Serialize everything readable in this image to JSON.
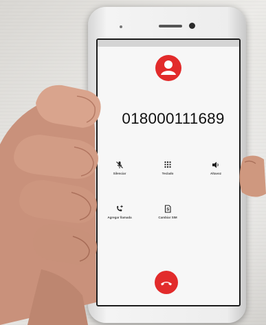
{
  "call": {
    "number": "018000111689",
    "avatar_icon": "person-icon",
    "accent_color": "#e22b2b"
  },
  "controls": [
    {
      "label": "Silenciar",
      "icon": "mute-icon"
    },
    {
      "label": "Teclado",
      "icon": "dialpad-icon"
    },
    {
      "label": "Altavoz",
      "icon": "speaker-icon"
    },
    {
      "label": "Agregar llamada",
      "icon": "add-call-icon"
    },
    {
      "label": "Cambiar SIM",
      "icon": "sim-icon"
    }
  ],
  "end_call": {
    "icon": "end-call-icon"
  }
}
